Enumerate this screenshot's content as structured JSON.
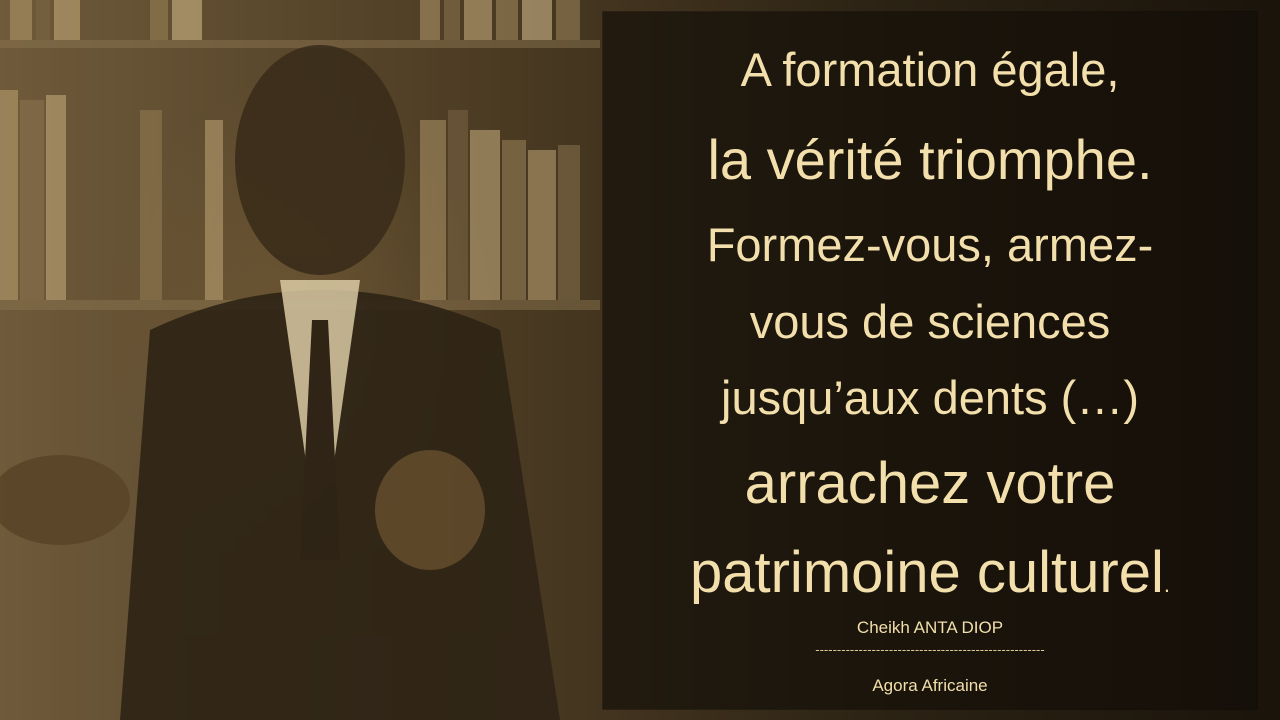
{
  "quote": {
    "line1": "A formation égale,",
    "line2": "la vérité triomphe.",
    "line3": "Formez-vous, armez-",
    "line4": "vous de sciences",
    "line5": "jusqu’aux dents (…)",
    "line6": "arrachez votre",
    "line7": "patrimoine culturel",
    "line7_end": "."
  },
  "attribution": {
    "author": "Cheikh ANTA DIOP",
    "divider": "-----------------------------------------------------",
    "source": "Agora Africaine"
  }
}
